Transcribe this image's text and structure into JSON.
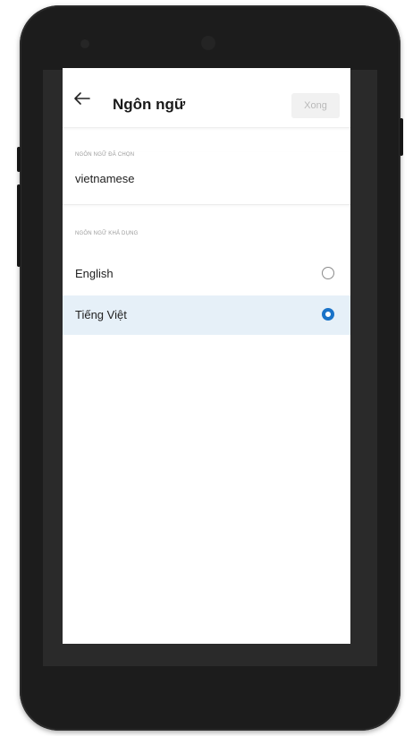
{
  "header": {
    "title": "Ngôn ngữ",
    "done_label": "Xong"
  },
  "selected_section": {
    "label": "NGÔN NGỮ ĐÃ CHỌN",
    "value": "vietnamese"
  },
  "available_section": {
    "label": "NGÔN NGỮ KHẢ DỤNG",
    "languages": [
      {
        "label": "English",
        "selected": false
      },
      {
        "label": "Tiếng Việt",
        "selected": true
      }
    ]
  },
  "colors": {
    "accent": "#1a73c8",
    "selected_row_bg": "#e6f0f8"
  },
  "icons": {
    "back": "arrow-left-icon",
    "radio_off": "radio-unchecked-icon",
    "radio_on": "radio-checked-icon"
  }
}
